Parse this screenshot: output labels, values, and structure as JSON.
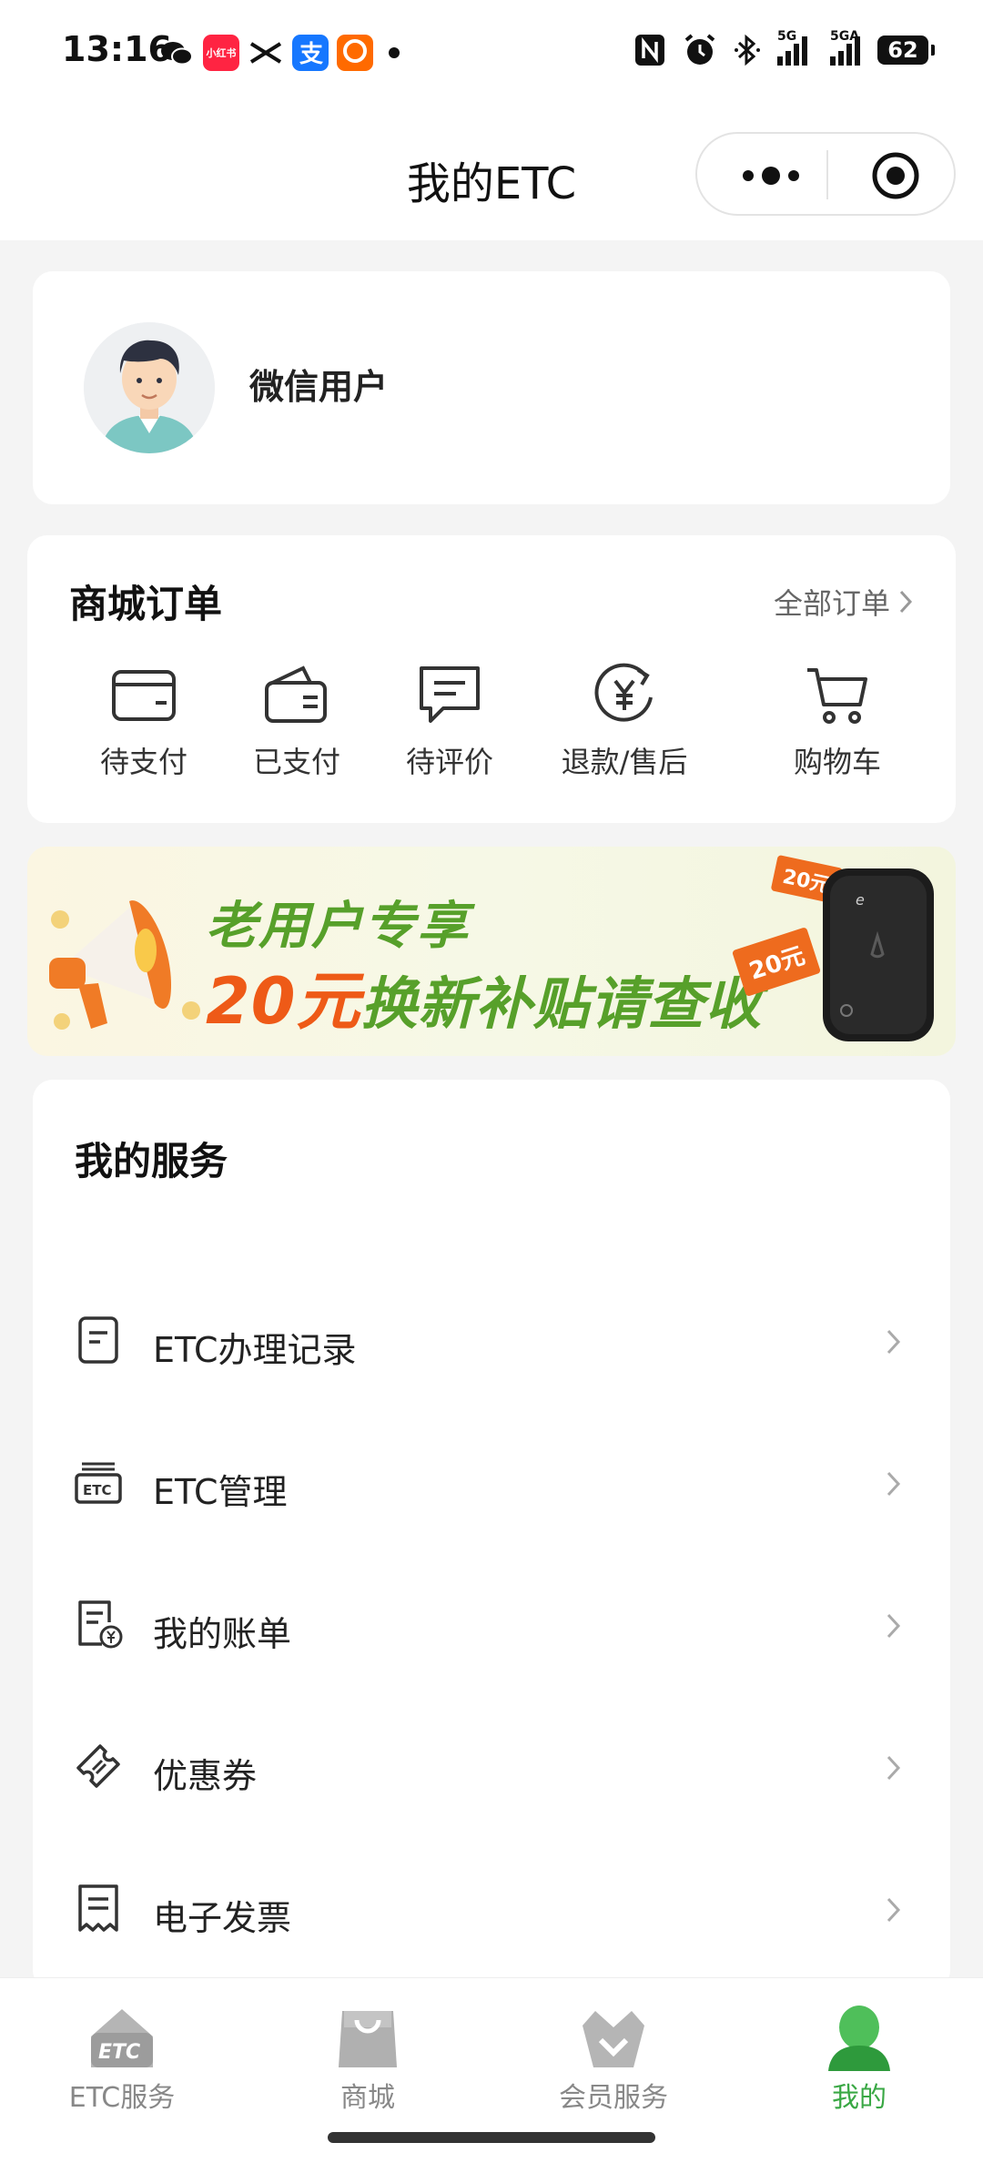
{
  "status_bar": {
    "time": "13:16",
    "app_icons": [
      "wechat-icon",
      "xiaohongshu-icon",
      "x-icon",
      "alipay-icon",
      "alibaba-1688-icon"
    ],
    "xiaohongshu_label": "小红书",
    "network_1": "5G",
    "network_2": "5GA",
    "battery": "62"
  },
  "header": {
    "title": "我的ETC"
  },
  "user": {
    "name": "微信用户"
  },
  "orders": {
    "title": "商城订单",
    "all_orders": "全部订单",
    "items": [
      {
        "label": "待支付",
        "icon": "wallet-icon"
      },
      {
        "label": "已支付",
        "icon": "paid-wallet-icon"
      },
      {
        "label": "待评价",
        "icon": "comment-icon"
      },
      {
        "label": "退款/售后",
        "icon": "refund-yen-icon"
      },
      {
        "label": "购物车",
        "icon": "cart-icon"
      }
    ]
  },
  "banner": {
    "line1": "老用户专享",
    "amount": "20元",
    "line2_rest": "换新补贴请查收",
    "tag1": "20元",
    "tag2": "20元",
    "accent_green": "#57a02a",
    "accent_orange": "#ee5a17"
  },
  "services": {
    "title": "我的服务",
    "items": [
      {
        "label": "ETC办理记录",
        "icon": "record-doc-icon"
      },
      {
        "label": "ETC管理",
        "icon": "etc-device-icon"
      },
      {
        "label": "我的账单",
        "icon": "bill-icon"
      },
      {
        "label": "优惠券",
        "icon": "coupon-icon"
      },
      {
        "label": "电子发票",
        "icon": "invoice-icon"
      }
    ]
  },
  "tab_bar": {
    "items": [
      {
        "label": "ETC服务",
        "icon": "etc-service-icon",
        "active": false
      },
      {
        "label": "商城",
        "icon": "shopping-bag-icon",
        "active": false
      },
      {
        "label": "会员服务",
        "icon": "crown-icon",
        "active": false
      },
      {
        "label": "我的",
        "icon": "person-icon",
        "active": true
      }
    ],
    "active_color": "#3aa845"
  }
}
